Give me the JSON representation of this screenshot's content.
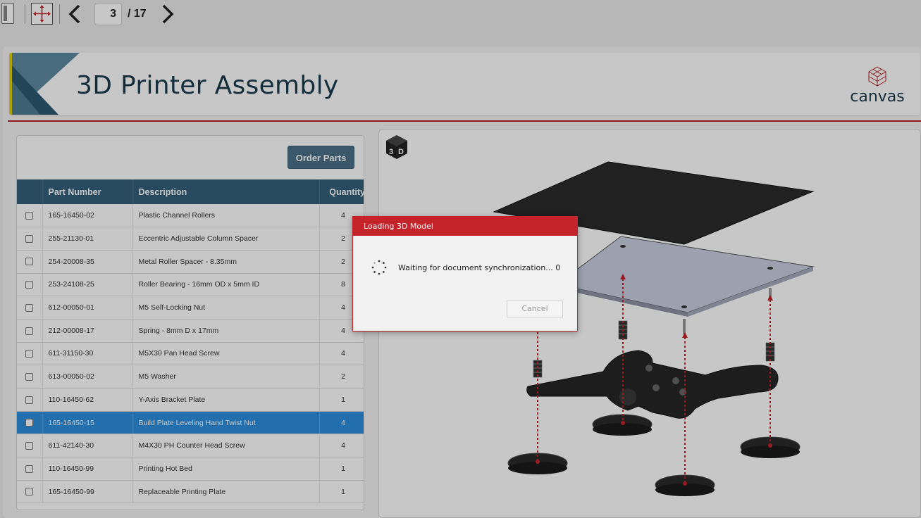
{
  "toolbar": {
    "current_page": "3",
    "total_pages": "/ 17",
    "prev_glyph": "❮",
    "next_glyph": "❯"
  },
  "header": {
    "title": "3D Printer Assembly",
    "brand": "canvas",
    "accent_color": "#e3d30c",
    "brand_color": "#b3262b"
  },
  "parts": {
    "order_button_label": "Order Parts",
    "columns": [
      "Part Number",
      "Description",
      "Quantity"
    ],
    "rows": [
      {
        "part": "165-16450-02",
        "desc": "Plastic Channel Rollers",
        "qty": "4"
      },
      {
        "part": "255-21130-01",
        "desc": "Eccentric Adjustable Column Spacer",
        "qty": "2"
      },
      {
        "part": "254-20008-35",
        "desc": "Metal Roller Spacer - 8.35mm",
        "qty": "2"
      },
      {
        "part": "253-24108-25",
        "desc": "Roller Bearing - 16mm OD x 5mm ID",
        "qty": "8"
      },
      {
        "part": "612-00050-01",
        "desc": "M5 Self-Locking Nut",
        "qty": "4"
      },
      {
        "part": "212-00008-17",
        "desc": "Spring - 8mm D x 17mm",
        "qty": "4"
      },
      {
        "part": "611-31150-30",
        "desc": "M5X30 Pan Head Screw",
        "qty": "4"
      },
      {
        "part": "613-00050-02",
        "desc": "M5 Washer",
        "qty": "2"
      },
      {
        "part": "110-16450-62",
        "desc": "Y-Axis Bracket Plate",
        "qty": "1"
      },
      {
        "part": "165-16450-15",
        "desc": "Build Plate Leveling Hand Twist Nut",
        "qty": "4",
        "selected": true
      },
      {
        "part": "611-42140-30",
        "desc": "M4X30 PH Counter Head Screw",
        "qty": "4"
      },
      {
        "part": "110-16450-99",
        "desc": "Printing Hot Bed",
        "qty": "1"
      },
      {
        "part": "165-16450-99",
        "desc": "Replaceable Printing Plate",
        "qty": "1"
      }
    ],
    "header_color": "#345f79",
    "selected_color": "#2d8fde"
  },
  "viewer": {
    "mode_icon": "3d-cube-icon"
  },
  "dialog": {
    "title": "Loading 3D Model",
    "message": "Waiting for document synchronization... 0",
    "cancel_label": "Cancel",
    "accent_color": "#c4232a"
  }
}
